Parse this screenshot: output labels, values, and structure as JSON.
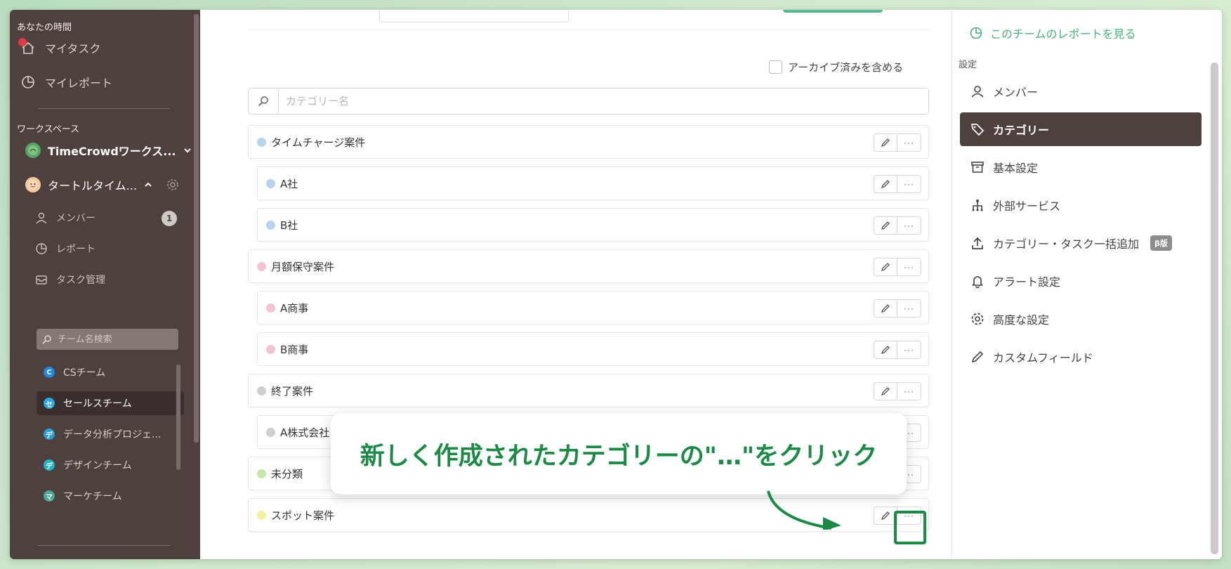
{
  "sidebar": {
    "your_time_label": "あなたの時間",
    "my_task": "マイタスク",
    "my_report": "マイレポート",
    "workspace_label": "ワークスペース",
    "workspace_name": "TimeCrowdワークス...",
    "team_group_name": "タートルタイム...",
    "sub": {
      "members": "メンバー",
      "members_count": "1",
      "report": "レポート",
      "task_manage": "タスク管理"
    },
    "team_search_placeholder": "チーム名検索",
    "teams": [
      {
        "label": "CSチーム",
        "badge": "C",
        "color": "#1e88e5",
        "active": false
      },
      {
        "label": "セールスチーム",
        "badge": "セ",
        "color": "#29a8e0",
        "active": true
      },
      {
        "label": "データ分析プロジェ...",
        "badge": "デ",
        "color": "#2a9fd6",
        "active": false
      },
      {
        "label": "デザインチーム",
        "badge": "デ",
        "color": "#1fb5c9",
        "active": false
      },
      {
        "label": "マーケチーム",
        "badge": "マ",
        "color": "#4aa79a",
        "active": false
      }
    ]
  },
  "main": {
    "archive_label": "アーカイブ済みを含める",
    "search_placeholder": "カテゴリー名",
    "categories": [
      {
        "name": "タイムチャージ案件",
        "color": "#b8d3f0",
        "level": 0
      },
      {
        "name": "A社",
        "color": "#b8d3f0",
        "level": 1
      },
      {
        "name": "B社",
        "color": "#b8d3f0",
        "level": 1
      },
      {
        "name": "月額保守案件",
        "color": "#f4c3d3",
        "level": 0
      },
      {
        "name": "A商事",
        "color": "#f4c3d3",
        "level": 1
      },
      {
        "name": "B商事",
        "color": "#f4c3d3",
        "level": 1
      },
      {
        "name": "終了案件",
        "color": "#cfcfcf",
        "level": 0
      },
      {
        "name": "A株式会社",
        "color": "#cfcfcf",
        "level": 1
      },
      {
        "name": "未分類",
        "color": "#c3e8a8",
        "level": 0
      },
      {
        "name": "スポット案件",
        "color": "#f5f0a0",
        "level": 0
      }
    ],
    "more_label": "···",
    "callout_text": "新しく作成されたカテゴリーの\"…\"をクリック"
  },
  "right_panel": {
    "report_link": "このチームのレポートを見る",
    "settings_label": "設定",
    "items": [
      {
        "label": "メンバー",
        "icon": "person-icon",
        "active": false
      },
      {
        "label": "カテゴリー",
        "icon": "tag-icon",
        "active": true
      },
      {
        "label": "基本設定",
        "icon": "archive-box-icon",
        "active": false
      },
      {
        "label": "外部サービス",
        "icon": "network-icon",
        "active": false
      },
      {
        "label": "カテゴリー・タスク一括追加",
        "icon": "upload-icon",
        "active": false,
        "badge": "β版"
      },
      {
        "label": "アラート設定",
        "icon": "bell-icon",
        "active": false
      },
      {
        "label": "高度な設定",
        "icon": "gear-icon",
        "active": false
      },
      {
        "label": "カスタムフィールド",
        "icon": "pencil-icon",
        "active": false
      }
    ]
  },
  "colors": {
    "sidebar_bg": "#4e403d",
    "accent_green": "#1a8a45",
    "link_green": "#47b27c"
  }
}
